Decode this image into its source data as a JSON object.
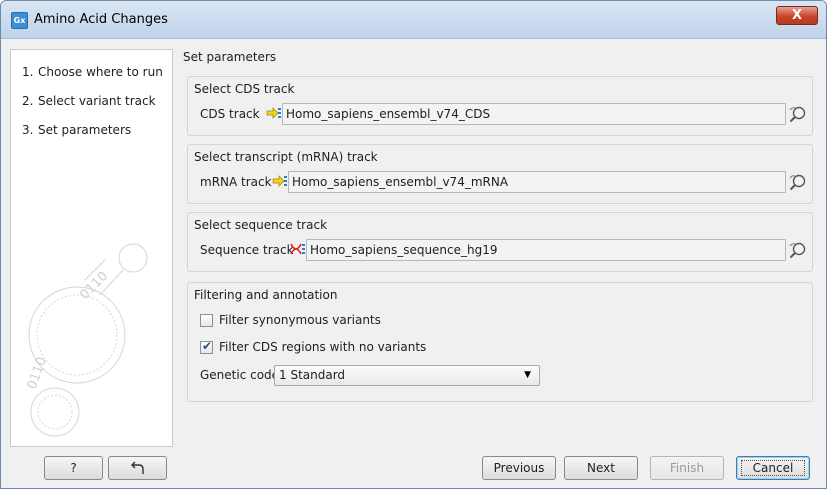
{
  "window": {
    "title": "Amino Acid Changes",
    "app_icon": "Gx",
    "close": "X"
  },
  "sidebar": {
    "steps": [
      {
        "num": "1.",
        "label": "Choose where to run"
      },
      {
        "num": "2.",
        "label": "Select variant track"
      },
      {
        "num": "3.",
        "label": "Set parameters"
      }
    ]
  },
  "content": {
    "header": "Set parameters",
    "cds": {
      "title": "Select CDS track",
      "label": "CDS track",
      "value": "Homo_sapiens_ensembl_v74_CDS"
    },
    "mrna": {
      "title": "Select transcript (mRNA) track",
      "label": "mRNA track",
      "value": "Homo_sapiens_ensembl_v74_mRNA"
    },
    "sequence": {
      "title": "Select sequence track",
      "label": "Sequence track",
      "value": "Homo_sapiens_sequence_hg19"
    },
    "filtering": {
      "title": "Filtering and annotation",
      "filter_synonymous": {
        "label": "Filter synonymous variants",
        "checked": false
      },
      "filter_cds": {
        "label": "Filter CDS regions with no variants",
        "checked": true
      },
      "genetic_code_label": "Genetic code",
      "genetic_code_value": "1 Standard"
    }
  },
  "footer": {
    "help": "?",
    "previous": "Previous",
    "next": "Next",
    "finish": "Finish",
    "cancel": "Cancel"
  }
}
